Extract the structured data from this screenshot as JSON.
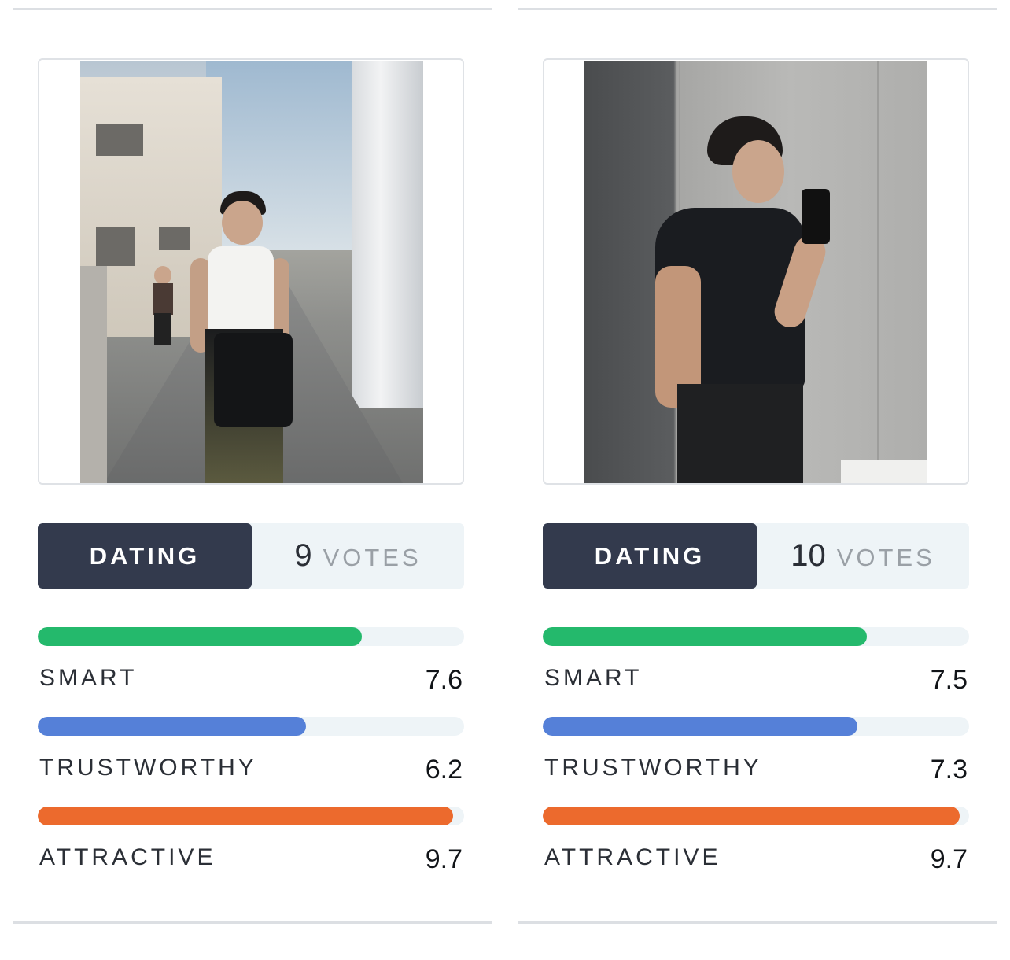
{
  "colors": {
    "smart": "#24b96c",
    "trustworthy": "#5580d8",
    "attractive": "#ec6a2d",
    "category_bg": "#333a4d",
    "track": "#eef4f7"
  },
  "profiles": [
    {
      "photo_alt": "Man in white tank top walking in a narrow street",
      "category": "DATING",
      "votes": "9",
      "votes_word": "VOTES",
      "metrics": [
        {
          "key": "smart",
          "label": "SMART",
          "value": "7.6",
          "fraction": 0.76
        },
        {
          "key": "trustworthy",
          "label": "TRUSTWORTHY",
          "value": "6.2",
          "fraction": 0.63
        },
        {
          "key": "attractive",
          "label": "ATTRACTIVE",
          "value": "9.7",
          "fraction": 0.975
        }
      ]
    },
    {
      "photo_alt": "Man in black t-shirt taking a mirror selfie",
      "category": "DATING",
      "votes": "10",
      "votes_word": "VOTES",
      "metrics": [
        {
          "key": "smart",
          "label": "SMART",
          "value": "7.5",
          "fraction": 0.76
        },
        {
          "key": "trustworthy",
          "label": "TRUSTWORTHY",
          "value": "7.3",
          "fraction": 0.738
        },
        {
          "key": "attractive",
          "label": "ATTRACTIVE",
          "value": "9.7",
          "fraction": 0.978
        }
      ]
    }
  ]
}
